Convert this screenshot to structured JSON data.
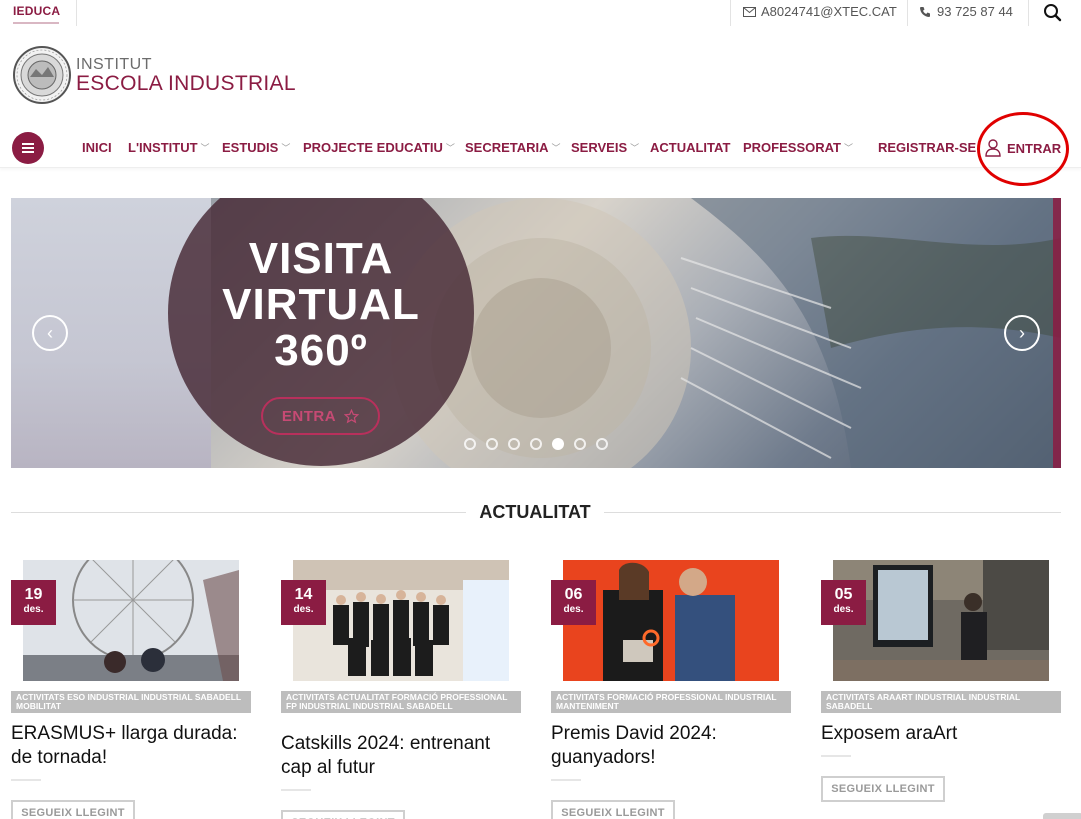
{
  "topbar": {
    "brand": "IEDUCA",
    "email": "A8024741@XTEC.CAT",
    "phone": "93 725 87 44"
  },
  "logo": {
    "line1": "INSTITUT",
    "line2": "ESCOLA INDUSTRIAL"
  },
  "nav": {
    "items": [
      {
        "label": "INICI",
        "dropdown": false
      },
      {
        "label": "L'INSTITUT",
        "dropdown": true
      },
      {
        "label": "ESTUDIS",
        "dropdown": true
      },
      {
        "label": "PROJECTE EDUCATIU",
        "dropdown": true
      },
      {
        "label": "SECRETARIA",
        "dropdown": true
      },
      {
        "label": "SERVEIS",
        "dropdown": true
      },
      {
        "label": "ACTUALITAT",
        "dropdown": false
      },
      {
        "label": "PROFESSORAT",
        "dropdown": true
      }
    ],
    "register": "REGISTRAR-SE",
    "login": "ENTRAR"
  },
  "slider": {
    "title_line1": "VISITA",
    "title_line2": "VIRTUAL",
    "title_line3": "360º",
    "button": "ENTRA",
    "slide_count": 7,
    "active_slide": 5
  },
  "section": {
    "title": "ACTUALITAT"
  },
  "news": [
    {
      "day": "19",
      "month": "des.",
      "category": "ACTIVITATS ESO INDUSTRIAL INDUSTRIAL SABADELL MOBILITAT",
      "title": "ERASMUS+ llarga durada: de tornada!",
      "button": "SEGUEIX LLEGINT"
    },
    {
      "day": "14",
      "month": "des.",
      "category": "ACTIVITATS ACTUALITAT FORMACIÓ PROFESSIONAL FP INDUSTRIAL INDUSTRIAL SABADELL",
      "title": "Catskills 2024: entrenant cap al futur",
      "button": "SEGUEIX LLEGINT"
    },
    {
      "day": "06",
      "month": "des.",
      "category": "ACTIVITATS FORMACIÓ PROFESSIONAL INDUSTRIAL MANTENIMENT",
      "title": "Premis David 2024: guanyadors!",
      "button": "SEGUEIX LLEGINT"
    },
    {
      "day": "05",
      "month": "des.",
      "category": "ACTIVITATS ARAART INDUSTRIAL INDUSTRIAL SABADELL",
      "title": "Exposem araArt",
      "button": "SEGUEIX LLEGINT"
    }
  ],
  "colors": {
    "brand": "#8b1c43",
    "highlight_circle": "#e00000"
  }
}
